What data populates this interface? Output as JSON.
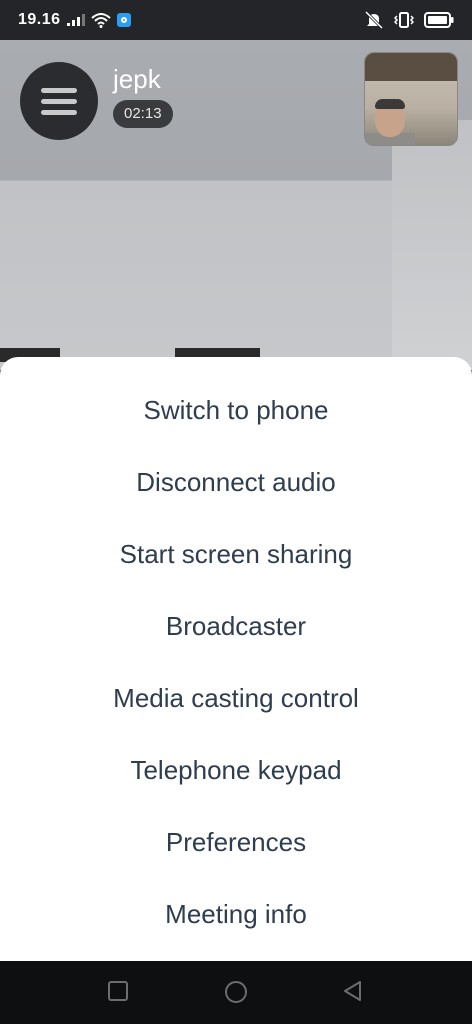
{
  "status_bar": {
    "time": "19.16",
    "icons": [
      "signal-icon",
      "wifi-icon",
      "app-notification-icon",
      "mute-icon",
      "vibrate-icon",
      "battery-icon"
    ]
  },
  "call": {
    "caller_name": "jepk",
    "timer": "02:13"
  },
  "menu": {
    "items": [
      "Switch to phone",
      "Disconnect audio",
      "Start screen sharing",
      "Broadcaster",
      "Media casting control",
      "Telephone keypad",
      "Preferences",
      "Meeting info"
    ]
  },
  "nav_bar": {
    "icons": [
      "recents-square-icon",
      "home-circle-icon",
      "back-triangle-icon"
    ]
  },
  "colors": {
    "sheet_text": "#2e3d4f",
    "sheet_bg": "#ffffff",
    "status_bar_bg": "#232528",
    "nav_bar_bg": "#0e0f10"
  }
}
